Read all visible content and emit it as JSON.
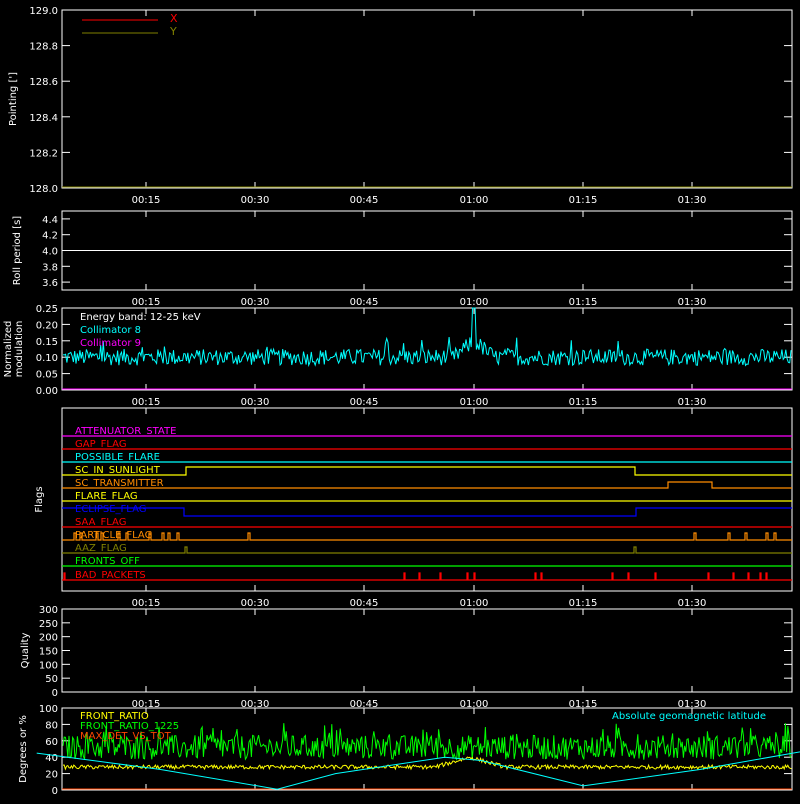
{
  "colors": {
    "background": "#000000",
    "axis": "#ffffff",
    "x_series": "#ff0000",
    "y_series": "#808000",
    "roll": "#ffffff",
    "collimator8": "#00ffff",
    "collimator9": "#ff00ff",
    "front_ratio": "#ffff00",
    "front_ratio_1225": "#00ff00",
    "max_det_vs_tot": "#ff4500",
    "geomag": "#00ffff"
  },
  "time_ticks": [
    "00:15",
    "00:30",
    "00:45",
    "01:00",
    "01:15",
    "01:30"
  ],
  "chart_data": [
    {
      "type": "line",
      "ylabel": "Pointing [']",
      "ylim": [
        128.0,
        129.0
      ],
      "yticks": [
        "129.0",
        "128.8",
        "128.6",
        "128.4",
        "128.2",
        "128.0"
      ],
      "legend": [
        "X",
        "Y"
      ],
      "series": [
        {
          "name": "X",
          "values": []
        },
        {
          "name": "Y",
          "values": []
        }
      ]
    },
    {
      "type": "line",
      "ylabel": "Roll period [s]",
      "ylim": [
        3.5,
        4.5
      ],
      "yticks": [
        "4.4",
        "4.2",
        "4.0",
        "3.8",
        "3.6"
      ],
      "series": [
        {
          "value": 4.0
        }
      ]
    },
    {
      "type": "line",
      "ylabel": [
        "Normalized",
        "modulation"
      ],
      "ylim": [
        0.0,
        0.25
      ],
      "yticks": [
        "0.25",
        "0.20",
        "0.15",
        "0.10",
        "0.05",
        "0.00"
      ],
      "legend": [
        "Energy band: 12-25 keV",
        "Collimator 8",
        "Collimator 9"
      ],
      "series": [
        {
          "name": "Collimator 8",
          "baseline": 0.1,
          "peak_time": "01:00",
          "peak_value": 0.25
        },
        {
          "name": "Collimator 9",
          "value": 0.0
        }
      ]
    },
    {
      "type": "line",
      "ylabel": "Flags",
      "flags": [
        {
          "name": "ATTENUATOR_STATE",
          "color": "#ff00ff"
        },
        {
          "name": "GAP_FLAG",
          "color": "#ff0000"
        },
        {
          "name": "POSSIBLE_FLARE",
          "color": "#00ffff"
        },
        {
          "name": "SC_IN_SUNLIGHT",
          "color": "#ffff00"
        },
        {
          "name": "SC_TRANSMITTER",
          "color": "#ff8c00"
        },
        {
          "name": "FLARE_FLAG",
          "color": "#ffff00"
        },
        {
          "name": "ECLIPSE_FLAG",
          "color": "#0000ff"
        },
        {
          "name": "SAA_FLAG",
          "color": "#ff0000"
        },
        {
          "name": "PARTICLE_FLAG",
          "color": "#ff8c00"
        },
        {
          "name": "AAZ_FLAG",
          "color": "#808000"
        },
        {
          "name": "FRONTS_OFF",
          "color": "#00ff00"
        },
        {
          "name": "BAD_PACKETS",
          "color": "#ff0000"
        }
      ]
    },
    {
      "type": "line",
      "ylabel": "Quality",
      "ylim": [
        0,
        300
      ],
      "yticks": [
        "300",
        "250",
        "200",
        "150",
        "100",
        "50",
        "0"
      ],
      "series": []
    },
    {
      "type": "line",
      "ylabel": "Degrees or %",
      "ylim": [
        0,
        100
      ],
      "yticks": [
        "100",
        "80",
        "60",
        "40",
        "20",
        "0"
      ],
      "legend": [
        "FRONT_RATIO",
        "FRONT_RATIO_1225",
        "MAX_DET_VS_TOT"
      ],
      "annotation": "Absolute geomagnetic latitude",
      "series": [
        {
          "name": "FRONT_RATIO",
          "baseline": 28
        },
        {
          "name": "FRONT_RATIO_1225",
          "baseline": 52
        },
        {
          "name": "MAX_DET_VS_TOT",
          "value": 0
        },
        {
          "name": "Absolute geomagnetic latitude",
          "x_minutes": [
            0,
            17,
            33,
            41,
            56,
            61,
            75,
            91,
            107
          ],
          "values": [
            45,
            25,
            1,
            20,
            40,
            36,
            5,
            25,
            50
          ]
        }
      ]
    }
  ]
}
